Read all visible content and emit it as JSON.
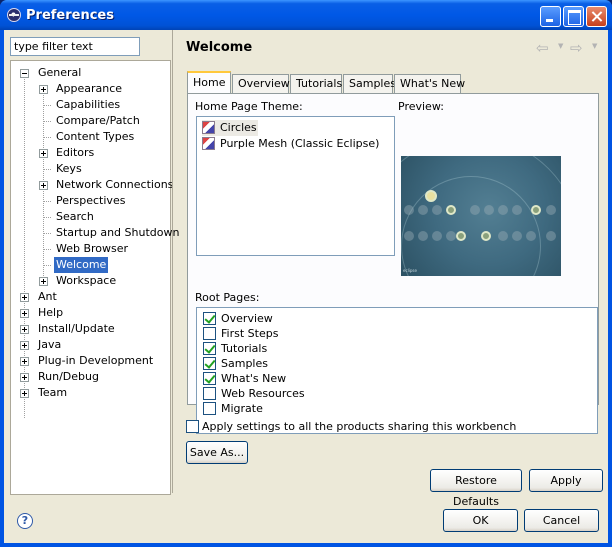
{
  "window": {
    "title": "Preferences"
  },
  "filter": {
    "placeholder": "type filter text",
    "value": "type filter text"
  },
  "tree": {
    "general": "General",
    "general_children": [
      "Appearance",
      "Capabilities",
      "Compare/Patch",
      "Content Types",
      "Editors",
      "Keys",
      "Network Connections",
      "Perspectives",
      "Search",
      "Startup and Shutdown",
      "Web Browser",
      "Welcome",
      "Workspace"
    ],
    "selected": "Welcome",
    "roots": [
      "Ant",
      "Help",
      "Install/Update",
      "Java",
      "Plug-in Development",
      "Run/Debug",
      "Team"
    ]
  },
  "page": {
    "title": "Welcome"
  },
  "tabs": [
    "Home",
    "Overview",
    "Tutorials",
    "Samples",
    "What's New"
  ],
  "active_tab": "Home",
  "home": {
    "theme_label": "Home Page Theme:",
    "themes": [
      "Circles",
      "Purple Mesh (Classic Eclipse)"
    ],
    "selected_theme": "Circles",
    "preview_label": "Preview:",
    "preview_caption": "eclipse",
    "root_pages_label": "Root Pages:",
    "root_pages": [
      {
        "label": "Overview",
        "checked": true
      },
      {
        "label": "First Steps",
        "checked": false
      },
      {
        "label": "Tutorials",
        "checked": true
      },
      {
        "label": "Samples",
        "checked": true
      },
      {
        "label": "What's New",
        "checked": true
      },
      {
        "label": "Web Resources",
        "checked": false
      },
      {
        "label": "Migrate",
        "checked": false
      }
    ]
  },
  "apply_all": {
    "label": "Apply settings to all the products sharing this workbench",
    "checked": false
  },
  "buttons": {
    "save_as": "Save As...",
    "restore_defaults": "Restore Defaults",
    "apply": "Apply",
    "ok": "OK",
    "cancel": "Cancel",
    "help": "?"
  }
}
